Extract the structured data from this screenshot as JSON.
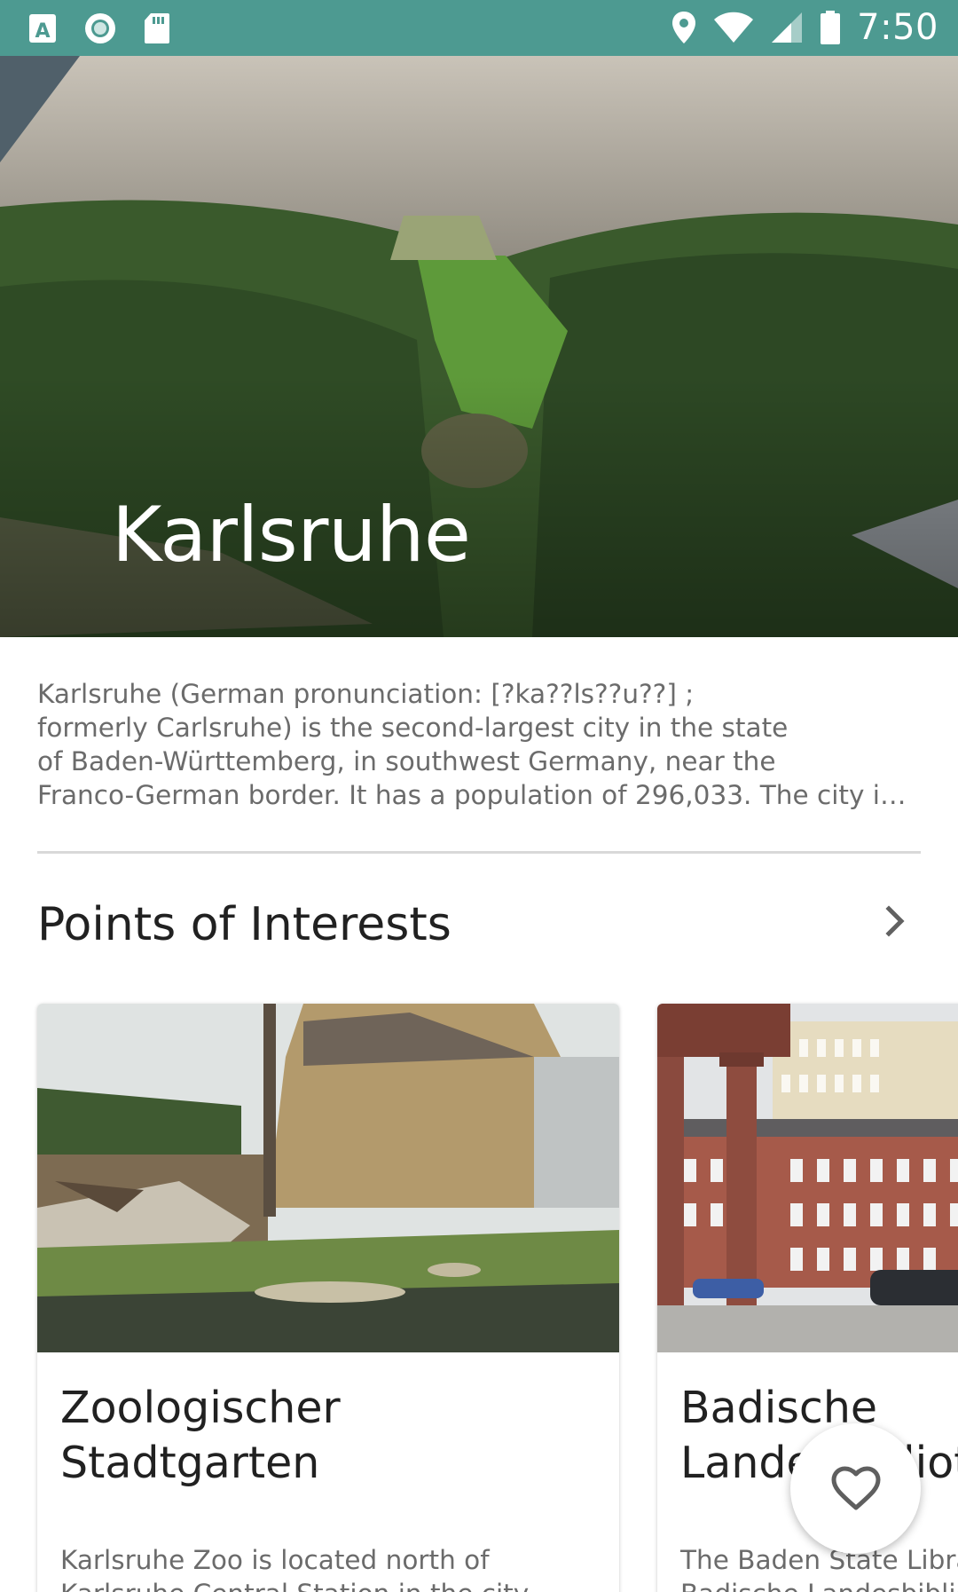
{
  "status_bar": {
    "time": "7:50",
    "left_icons": [
      "font-icon",
      "circle-icon",
      "sd-card-icon"
    ],
    "right_icons": [
      "location-icon",
      "wifi-icon",
      "signal-icon",
      "battery-icon"
    ]
  },
  "hero": {
    "title": "Karlsruhe"
  },
  "description": {
    "lines": [
      "Karlsruhe (German pronunciation: [?ka??ls??u??] ;",
      "formerly Carlsruhe) is the second-largest city in the state",
      "of Baden-Württemberg, in southwest Germany, near the",
      "Franco-German border. It has a population of 296,033. The city i…"
    ]
  },
  "section": {
    "title": "Points of Interests",
    "more_icon": "chevron-right-icon"
  },
  "cards": [
    {
      "title_lines": [
        "Zoologischer",
        "Stadtgarten"
      ],
      "text_lines": [
        "Karlsruhe Zoo is located north of",
        "Karlsruhe Central Station in the city"
      ]
    },
    {
      "title_lines": [
        "Badische",
        "Landesbibliothek"
      ],
      "text_lines": [
        "The Baden State Library",
        "Badische Landesbibliothek"
      ]
    }
  ],
  "fab": {
    "icon": "heart-outline-icon"
  },
  "colors": {
    "status_bar": "#4d9a91",
    "text_primary": "#212121",
    "text_secondary": "#6b6b6b"
  }
}
